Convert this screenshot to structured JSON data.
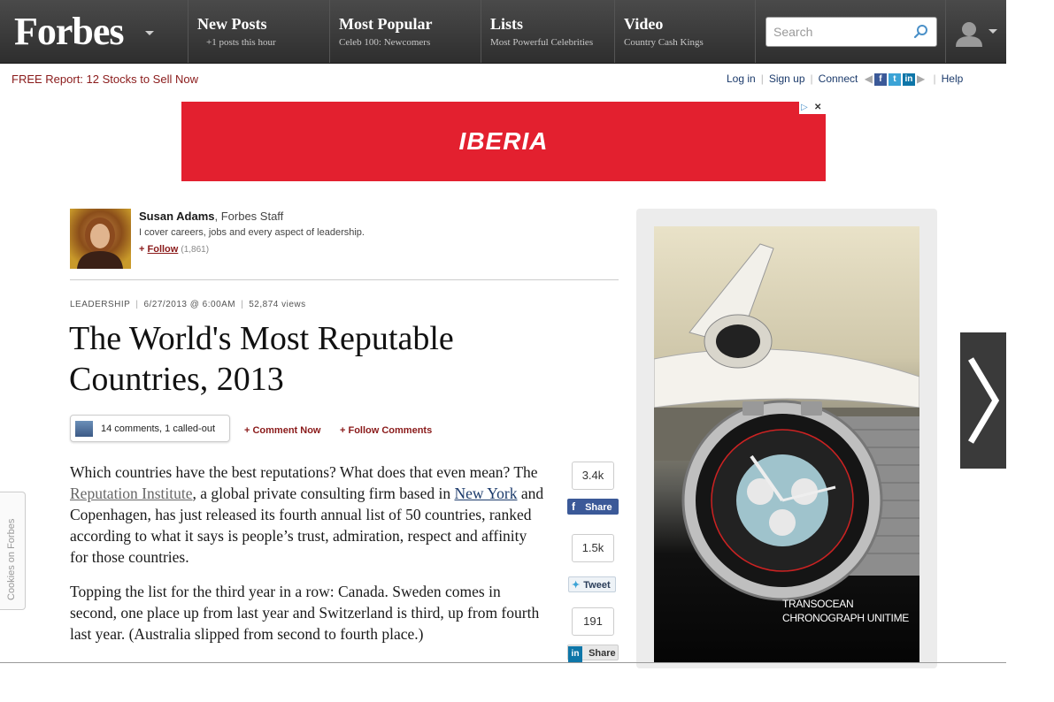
{
  "nav": {
    "logo": "Forbes",
    "items": [
      {
        "title": "New Posts",
        "sub": "+1 posts this hour"
      },
      {
        "title": "Most Popular",
        "sub": "Celeb 100: Newcomers"
      },
      {
        "title": "Lists",
        "sub": "Most Powerful Celebrities"
      },
      {
        "title": "Video",
        "sub": "Country Cash Kings"
      }
    ],
    "search_placeholder": "Search"
  },
  "util": {
    "promo": "FREE Report: 12 Stocks to Sell Now",
    "login": "Log in",
    "signup": "Sign up",
    "connect": "Connect",
    "help": "Help"
  },
  "banner": {
    "brand": "IBERIA"
  },
  "author": {
    "name": "Susan Adams",
    "role": ", Forbes Staff",
    "bio": "I cover careers, jobs and every aspect of leadership.",
    "follow": "Follow",
    "followers": "(1,861)"
  },
  "article": {
    "section": "LEADERSHIP",
    "date": "6/27/2013 @ 6:00AM",
    "views": "52,874 views",
    "title": "The World's Most Reputable Countries, 2013",
    "comments": "14 comments, 1 called-out",
    "comment_now": "+ Comment Now",
    "follow_comments": "+ Follow Comments",
    "p1_a": "Which countries have the best reputations? What does that even mean? The ",
    "p1_link1": "Reputation Institute",
    "p1_b": ", a global private consulting firm based in ",
    "p1_link2": "New York",
    "p1_c": " and Copenhagen, has just released its fourth annual list of 50 countries, ranked according to what it says is people’s trust, admiration, respect and affinity for those countries.",
    "p2": "Topping the list for the third year in a row: Canada. Sweden comes in second, one place up from last year and Switzerland is third, up from fourth last year. (Australia slipped from second to fourth place.)"
  },
  "share": {
    "fb_count": "3.4k",
    "fb_label": "Share",
    "tw_count": "1.5k",
    "tw_label": "Tweet",
    "li_count": "191",
    "li_label": "Share"
  },
  "right_ad": {
    "line1": "TRANSOCEAN",
    "line2": "CHRONOGRAPH UNITIME"
  },
  "cookies": "Cookies on Forbes",
  "colors": {
    "accent_red": "#8a1a1a",
    "link_blue": "#1b3a6b",
    "ad_red": "#e3202f",
    "facebook": "#3b5998"
  }
}
